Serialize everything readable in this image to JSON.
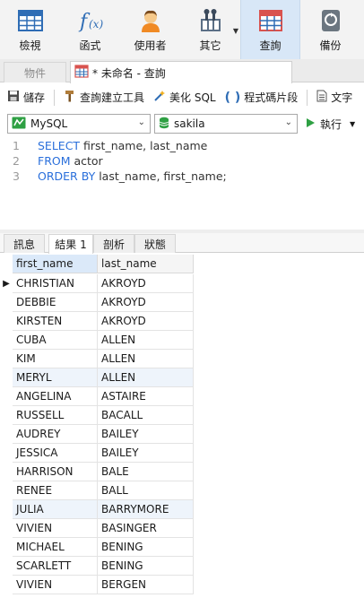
{
  "toolbar": {
    "items": [
      {
        "label": "檢視",
        "icon": "table-view-icon"
      },
      {
        "label": "函式",
        "icon": "function-icon"
      },
      {
        "label": "使用者",
        "icon": "user-icon"
      },
      {
        "label": "其它",
        "icon": "tools-icon"
      },
      {
        "label": "查詢",
        "icon": "query-grid-icon"
      },
      {
        "label": "備份",
        "icon": "backup-icon"
      }
    ],
    "active_index": 4
  },
  "tabs": {
    "objects": "物件",
    "query": "* 未命名 - 查詢"
  },
  "query_toolbar": {
    "save": "儲存",
    "builder": "查詢建立工具",
    "beautify": "美化 SQL",
    "snippet": "程式碼片段",
    "text": "文字"
  },
  "connection": {
    "server": "MySQL",
    "database": "sakila",
    "run": "執行"
  },
  "editor": {
    "lines": [
      {
        "num": "1",
        "keyword": "SELECT",
        "rest": " first_name, last_name"
      },
      {
        "num": "2",
        "keyword": "FROM",
        "rest": " actor"
      },
      {
        "num": "3",
        "keyword": "ORDER BY",
        "rest": " last_name, first_name;"
      }
    ]
  },
  "result_tabs": {
    "messages": "訊息",
    "result1": "結果 1",
    "profile": "剖析",
    "status": "狀態"
  },
  "grid": {
    "columns": [
      "first_name",
      "last_name"
    ],
    "rows": [
      [
        "CHRISTIAN",
        "AKROYD"
      ],
      [
        "DEBBIE",
        "AKROYD"
      ],
      [
        "KIRSTEN",
        "AKROYD"
      ],
      [
        "CUBA",
        "ALLEN"
      ],
      [
        "KIM",
        "ALLEN"
      ],
      [
        "MERYL",
        "ALLEN"
      ],
      [
        "ANGELINA",
        "ASTAIRE"
      ],
      [
        "RUSSELL",
        "BACALL"
      ],
      [
        "AUDREY",
        "BAILEY"
      ],
      [
        "JESSICA",
        "BAILEY"
      ],
      [
        "HARRISON",
        "BALE"
      ],
      [
        "RENEE",
        "BALL"
      ],
      [
        "JULIA",
        "BARRYMORE"
      ],
      [
        "VIVIEN",
        "BASINGER"
      ],
      [
        "MICHAEL",
        "BENING"
      ],
      [
        "SCARLETT",
        "BENING"
      ],
      [
        "VIVIEN",
        "BERGEN"
      ]
    ],
    "current_row": 0
  },
  "colors": {
    "keyword": "#2a6fdb",
    "active_toolbar": "#d8e7f7",
    "run_green": "#2ea043"
  }
}
